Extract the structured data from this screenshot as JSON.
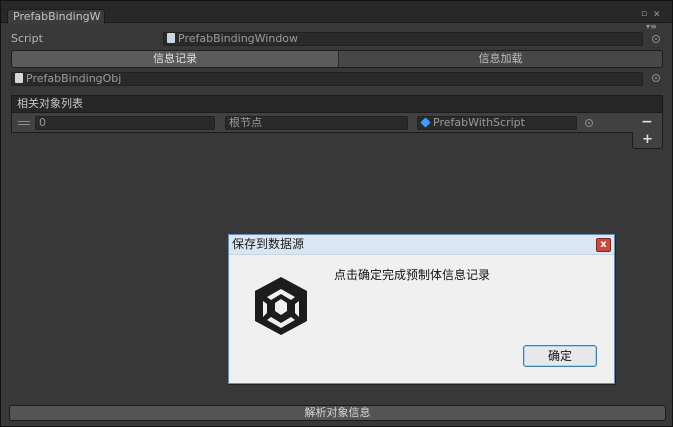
{
  "tab": {
    "title": "PrefabBindingW"
  },
  "script_row": {
    "label": "Script",
    "value": "PrefabBindingWindow"
  },
  "toolbar": {
    "tab_record": "信息记录",
    "tab_load": "信息加载"
  },
  "prefab_obj": {
    "value": "PrefabBindingObj"
  },
  "list": {
    "header": "相关对象列表",
    "items": [
      {
        "index": "0",
        "name": "根节点",
        "object": "PrefabWithScript"
      }
    ],
    "remove_label": "−",
    "add_label": "+"
  },
  "bottom_button": {
    "label": "解析对象信息"
  },
  "dialog": {
    "title": "保存到数据源",
    "message": "点击确定完成预制体信息记录",
    "ok_label": "确定",
    "close_label": "x"
  },
  "colors": {
    "panel_bg": "#383838",
    "dialog_bg": "#f0f0f0",
    "active_tab": "#5a5a5a"
  }
}
